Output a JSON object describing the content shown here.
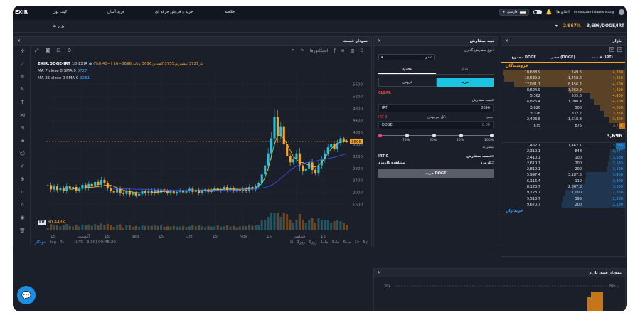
{
  "topbar": {
    "logo": "EXIR",
    "menu": [
      "کیف پول",
      "خرید آسان",
      "خرید و فروش حرفه ای",
      "خلاصه"
    ],
    "notifications": "اعلان ها",
    "language": "فارسی",
    "username": "mmoazzami.daneshsaz@"
  },
  "subbar": {
    "tools": "ابزار ها",
    "ticker_change": "2.967%",
    "ticker_symbol": "3,696/DOGE/IRT"
  },
  "chart_panel": {
    "title": "نمودار قیمت",
    "indicators": "اندیکاتورها",
    "legend": {
      "symbol": "EXIR:DOGE-IRT",
      "interval": "1D",
      "exchange": "EXIR",
      "ohlc": "باز3721 بیشترین3755 کمترین3696 پایانی3696−16 (−0.43%)",
      "ma7": "MA 7 close 0 SMA 9",
      "ma7_val": "3727",
      "ma25": "MA 25 close 0 SMA 9",
      "ma25_val": "3281"
    },
    "volume_label": "60.443K",
    "price_tag": "3696",
    "y_ticks": [
      "5600",
      "5200",
      "4800",
      "4400",
      "4000",
      "3600",
      "3200",
      "2800",
      "2400",
      "2000",
      "1600"
    ],
    "x_ticks": [
      "15",
      "آگوست",
      "15",
      "Sep",
      "15",
      "Oct",
      "15",
      "Nov",
      "15",
      "دسامبر",
      "15"
    ],
    "bottom": {
      "scale": [
        "خودکار",
        "log",
        "%"
      ],
      "clock": "(UTC+3:30) 09:45:20",
      "ranges": [
        "5y",
        "1y",
        "6ماه",
        "3ماه",
        "1ماه",
        "5روز",
        "1روز"
      ]
    }
  },
  "chart_data": {
    "type": "candlestick",
    "ylim": [
      1400,
      5800
    ],
    "close": [
      2240,
      2100,
      2200,
      2080,
      2150,
      2050,
      2200,
      2120,
      2180,
      2060,
      2120,
      2250,
      2150,
      2280,
      2200,
      2350,
      2250,
      2420,
      2300,
      2150,
      2050,
      2000,
      2120,
      1980,
      1950,
      2050,
      1930,
      1980,
      1900,
      1950,
      2050,
      1970,
      2060,
      1980,
      2080,
      2000,
      2100,
      2050,
      1980,
      2040,
      1960,
      2020,
      2080,
      2000,
      2050,
      2120,
      2020,
      2090,
      1990,
      2060,
      2100,
      2020,
      2080,
      2150,
      2050,
      2110,
      2180,
      2080,
      2140,
      2060,
      2100,
      2040,
      2120,
      2050,
      2180,
      2100,
      2200,
      2300,
      2600,
      2900,
      3300,
      3800,
      4500,
      3900,
      4200,
      3600,
      3200,
      3000,
      3100,
      3300,
      2900,
      2700,
      2800,
      3000,
      2750,
      2650,
      2900,
      3100,
      3300,
      3500,
      3600,
      3450,
      3650,
      3800,
      3721,
      3696
    ],
    "ma7": [
      2100,
      2110,
      2130,
      2150,
      2140,
      2150,
      2160,
      2170,
      2180,
      2200,
      2210,
      2230,
      2250,
      2240,
      2200,
      2160,
      2120,
      2080,
      2050,
      2030,
      2010,
      2000,
      1990,
      1985,
      1980,
      1980,
      1990,
      2000,
      2010,
      2020,
      2030,
      2040,
      2050,
      2055,
      2060,
      2060,
      2060,
      2060,
      2050,
      2055,
      2060,
      2065,
      2070,
      2075,
      2080,
      2085,
      2090,
      2095,
      2100,
      2105,
      2110,
      2115,
      2110,
      2110,
      2105,
      2110,
      2120,
      2130,
      2140,
      2150,
      2200,
      2300,
      2500,
      2800,
      3200,
      3600,
      3900,
      3900,
      3800,
      3600,
      3400,
      3200,
      3100,
      3000,
      3000,
      2950,
      2900,
      2850,
      2850,
      2900,
      3000,
      3150,
      3300,
      3450,
      3550,
      3620,
      3680,
      3710,
      3727
    ],
    "ma25": [
      2150,
      2150,
      2145,
      2140,
      2138,
      2135,
      2130,
      2128,
      2125,
      2120,
      2118,
      2115,
      2110,
      2108,
      2105,
      2100,
      2098,
      2095,
      2090,
      2085,
      2082,
      2080,
      2078,
      2076,
      2074,
      2072,
      2070,
      2068,
      2066,
      2065,
      2064,
      2063,
      2062,
      2062,
      2062,
      2063,
      2064,
      2065,
      2066,
      2068,
      2070,
      2072,
      2075,
      2078,
      2082,
      2086,
      2090,
      2095,
      2100,
      2105,
      2112,
      2120,
      2130,
      2145,
      2165,
      2195,
      2240,
      2300,
      2380,
      2470,
      2560,
      2650,
      2740,
      2820,
      2880,
      2930,
      2960,
      2990,
      3010,
      3030,
      3050,
      3070,
      3090,
      3110,
      3130,
      3150,
      3170,
      3200,
      3230,
      3260,
      3281
    ]
  },
  "order_panel": {
    "title": "ثبت سفارش",
    "order_type_label": "نوع سفارش گذاری:",
    "order_type_value": "عادی",
    "tabs": [
      "بازار",
      "محدود"
    ],
    "buy": "خرید",
    "sell": "فروش",
    "clear": "CLEAR",
    "price_label": "قیمت سفارش",
    "price_value": "3696",
    "price_unit": "IRT",
    "volume_label": "حجم",
    "balance_label": "کل موجودی:",
    "balance_value": "IRT 0",
    "volume_value": "0.00",
    "volume_unit": "DOGE",
    "slider_labels": [
      "100%",
      "75%",
      "50%",
      "25%"
    ],
    "est_label": "پیشرانه",
    "order_amount_label": "قیمت سفارش:",
    "order_amount_value": "IRT 0",
    "fee_label": "کارمزد:",
    "fee_value": "مشاهده کارمزد",
    "submit": "خرید DOGE"
  },
  "market_panel": {
    "title": "بازار",
    "columns": [
      "قیمت (IRT)",
      "حجم (DOGE)",
      "مجموع DOGE"
    ],
    "sellers_label": "فروشندگان",
    "buyers_label": "خریداران",
    "mid_price": "3,696",
    "asks": [
      {
        "price": "4,780",
        "vol": "149.6",
        "total": "18,688.9"
      },
      {
        "price": "4,650",
        "vol": "1,458.2",
        "total": "18,539.3"
      },
      {
        "price": "4,500",
        "vol": "8,456.2",
        "total": "17,081.1"
      },
      {
        "price": "4,490",
        "vol": "3,262.9",
        "total": "8,624.9"
      },
      {
        "price": "4,400",
        "vol": "535.6",
        "total": "5,362"
      },
      {
        "price": "4,100",
        "vol": "1,000.4",
        "total": "4,826.4"
      },
      {
        "price": "4,050",
        "vol": "500",
        "total": "3,826"
      },
      {
        "price": "3,850",
        "vol": "832.2",
        "total": "3,326"
      },
      {
        "price": "3,800",
        "vol": "1,618.8",
        "total": "2,493.8"
      },
      {
        "price": "3,706",
        "vol": "875",
        "total": "875"
      }
    ],
    "bids": [
      {
        "price": "3,684",
        "vol": "1,462.1",
        "total": "1,462.1"
      },
      {
        "price": "3,677",
        "vol": "848",
        "total": "2,310.1"
      },
      {
        "price": "3,588",
        "vol": "100",
        "total": "2,410.1"
      },
      {
        "price": "3,583",
        "vol": "200",
        "total": "2,610.1"
      },
      {
        "price": "3,500",
        "vol": "200",
        "total": "2,810.1"
      },
      {
        "price": "3,400",
        "vol": "3,187.3",
        "total": "5,997.4"
      },
      {
        "price": "3,300",
        "vol": "119",
        "total": "6,116.4"
      },
      {
        "price": "3,100",
        "vol": "2,007.3",
        "total": "8,123.7"
      },
      {
        "price": "2,250",
        "vol": "1,000",
        "total": "9,123.7"
      },
      {
        "price": "2,200",
        "vol": "395",
        "total": "9,518.7"
      },
      {
        "price": "2,180",
        "vol": "200",
        "total": "9,670.7"
      }
    ]
  },
  "depth_panel": {
    "title": "نمودار عمق بازار",
    "left_tick": "20k",
    "right_tick": "20k"
  },
  "colors": {
    "background": "#1b1f29",
    "accent": "#1bc4e0",
    "up": "#2ecc71",
    "down": "#e74c3c",
    "sell": "#f5a623",
    "buy": "#3da5ff"
  }
}
